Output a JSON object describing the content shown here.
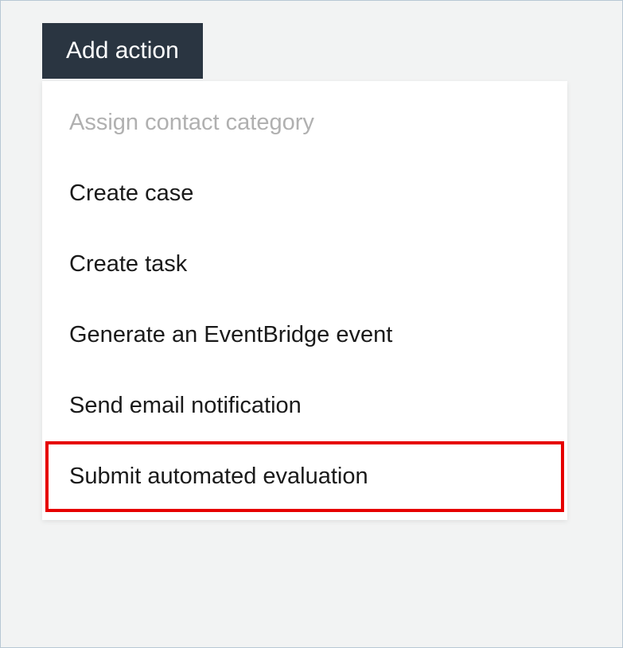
{
  "button": {
    "label": "Add action"
  },
  "dropdown": {
    "items": [
      {
        "label": "Assign contact category",
        "disabled": true,
        "highlighted": false
      },
      {
        "label": "Create case",
        "disabled": false,
        "highlighted": false
      },
      {
        "label": "Create task",
        "disabled": false,
        "highlighted": false
      },
      {
        "label": "Generate an EventBridge event",
        "disabled": false,
        "highlighted": false
      },
      {
        "label": "Send email notification",
        "disabled": false,
        "highlighted": false
      },
      {
        "label": "Submit automated evaluation",
        "disabled": false,
        "highlighted": true
      }
    ]
  }
}
